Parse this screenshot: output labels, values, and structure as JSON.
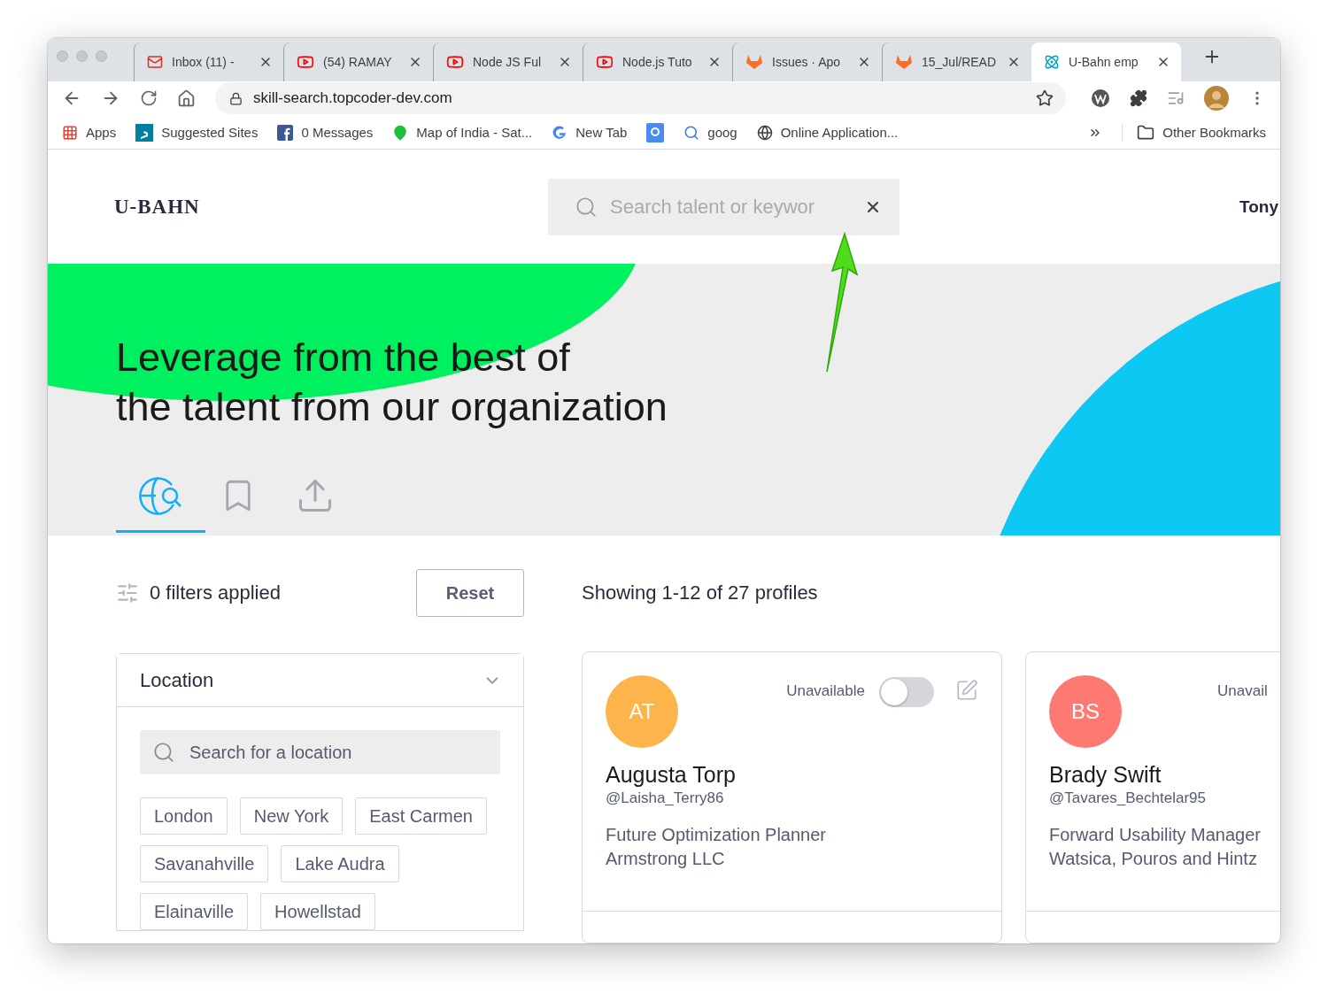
{
  "browser": {
    "tabs": [
      {
        "title": "Inbox (11) -",
        "kind": "mail",
        "selected": false
      },
      {
        "title": "(54) RAMAY",
        "kind": "video",
        "selected": false
      },
      {
        "title": "Node JS Ful",
        "kind": "video",
        "selected": false
      },
      {
        "title": "Node.js Tuto",
        "kind": "video",
        "selected": false
      },
      {
        "title": "Issues · Apo",
        "kind": "fox",
        "selected": false
      },
      {
        "title": "15_Jul/READ",
        "kind": "fox",
        "selected": false
      },
      {
        "title": "U-Bahn emp",
        "kind": "atom",
        "selected": true
      }
    ],
    "url": "skill-search.topcoder-dev.com",
    "bookmarks": [
      {
        "label": "Apps",
        "kind": "grid"
      },
      {
        "label": "Suggested Sites",
        "kind": "bing"
      },
      {
        "label": "0 Messages",
        "kind": "facebook"
      },
      {
        "label": "Map of India - Sat...",
        "kind": "pin"
      },
      {
        "label": "New Tab",
        "kind": "google"
      },
      {
        "kind": "gplus"
      },
      {
        "label": "goog",
        "kind": "magnifier"
      },
      {
        "label": "Online Application...",
        "kind": "globe"
      }
    ],
    "other_bookmarks": "Other Bookmarks"
  },
  "header": {
    "logo": "U-BAHN",
    "search": {
      "placeholder": "Search talent or keywor"
    },
    "user": "Tony"
  },
  "hero": {
    "heading": [
      "Leverage from the best of",
      "the talent from our organization"
    ],
    "tabs": [
      {
        "kind": "globe-search",
        "selected": true
      },
      {
        "kind": "bookmark",
        "selected": false
      },
      {
        "kind": "upload",
        "selected": false
      }
    ]
  },
  "filters": {
    "summary": "0 filters applied",
    "reset": "Reset",
    "panel": {
      "title": "Location",
      "expanded": true,
      "search_placeholder": "Search for a location",
      "chips": [
        "London",
        "New York",
        "East Carmen",
        "Savanahville",
        "Lake Audra",
        "Elainaville",
        "Howellstad"
      ]
    }
  },
  "results": {
    "summary": "Showing 1-12 of 27 profiles",
    "profiles": [
      {
        "initials": "AT",
        "color": "#fdb44b",
        "availability": "Unavailable",
        "on": false,
        "name": "Augusta Torp",
        "handle": "@Laisha_Terry86",
        "title": "Future Optimization Planner",
        "company": "Armstrong LLC"
      },
      {
        "initials": "BS",
        "color": "#fe7971",
        "availability": "Unavail",
        "name": "Brady Swift",
        "handle": "@Tavares_Bechtelar95",
        "title": "Forward Usability Manager",
        "company": "Watsica, Pouros and Hintz"
      }
    ]
  }
}
